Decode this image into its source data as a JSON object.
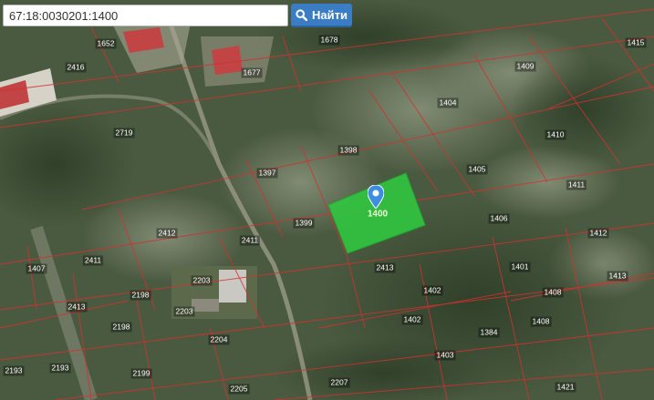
{
  "search": {
    "value": "67:18:0030201:1400",
    "button_label": "Найти",
    "button_icon": "search-icon"
  },
  "map": {
    "highlight_color": "#2ecc40",
    "boundary_color": "#d43030",
    "selected_parcel_label": "1400",
    "parcel_labels": [
      "1652",
      "1678",
      "1415",
      "2416",
      "1409",
      "1677",
      "1397",
      "1398",
      "1404",
      "2719",
      "1410",
      "1405",
      "1411",
      "1406",
      "1399",
      "1412",
      "2412",
      "2411",
      "1407",
      "1401",
      "2413",
      "2411",
      "1413",
      "1408",
      "1402",
      "2198",
      "2413",
      "1402",
      "1408",
      "1384",
      "2198",
      "2203",
      "2203",
      "1403",
      "2204",
      "2193",
      "2193",
      "2199",
      "2207",
      "2205",
      "1421"
    ]
  }
}
